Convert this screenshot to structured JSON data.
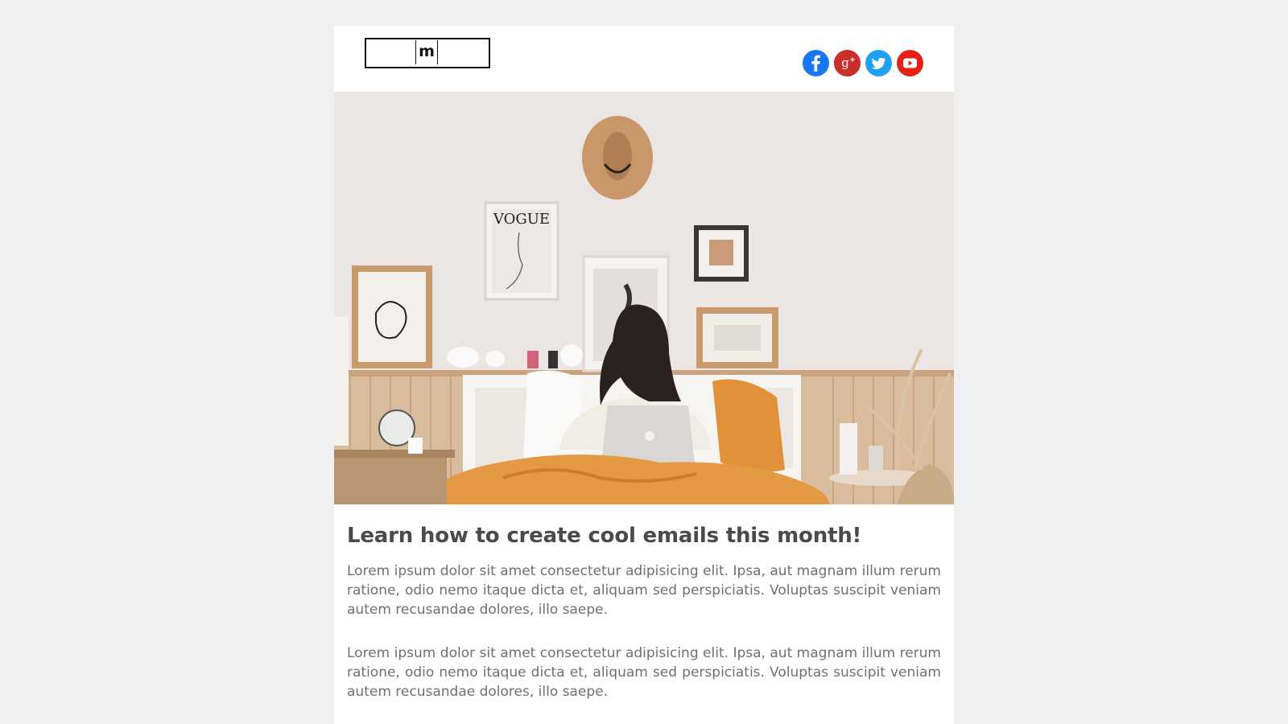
{
  "header": {
    "logo_letter": "m",
    "social": [
      {
        "icon": "facebook-icon",
        "color": "#1877f2",
        "glyph": "f"
      },
      {
        "icon": "google-plus-icon",
        "color": "#db4437",
        "glyph": "g+"
      },
      {
        "icon": "twitter-icon",
        "color": "#1da1f2",
        "glyph": "twitter"
      },
      {
        "icon": "youtube-icon",
        "color": "#e62117",
        "glyph": "play"
      }
    ]
  },
  "hero": {
    "poster_text": "VOGUE"
  },
  "article": {
    "title": "Learn how to create cool emails this month!",
    "paragraphs": [
      "Lorem ipsum dolor sit amet consectetur adipisicing elit. Ipsa, aut magnam illum rerum ratione, odio nemo itaque dicta et, aliquam sed perspiciatis. Voluptas suscipit veniam autem recusandae dolores, illo saepe.",
      "Lorem ipsum dolor sit amet consectetur adipisicing elit. Ipsa, aut magnam illum rerum ratione, odio nemo itaque dicta et, aliquam sed perspiciatis. Voluptas suscipit veniam autem recusandae dolores, illo saepe."
    ]
  }
}
